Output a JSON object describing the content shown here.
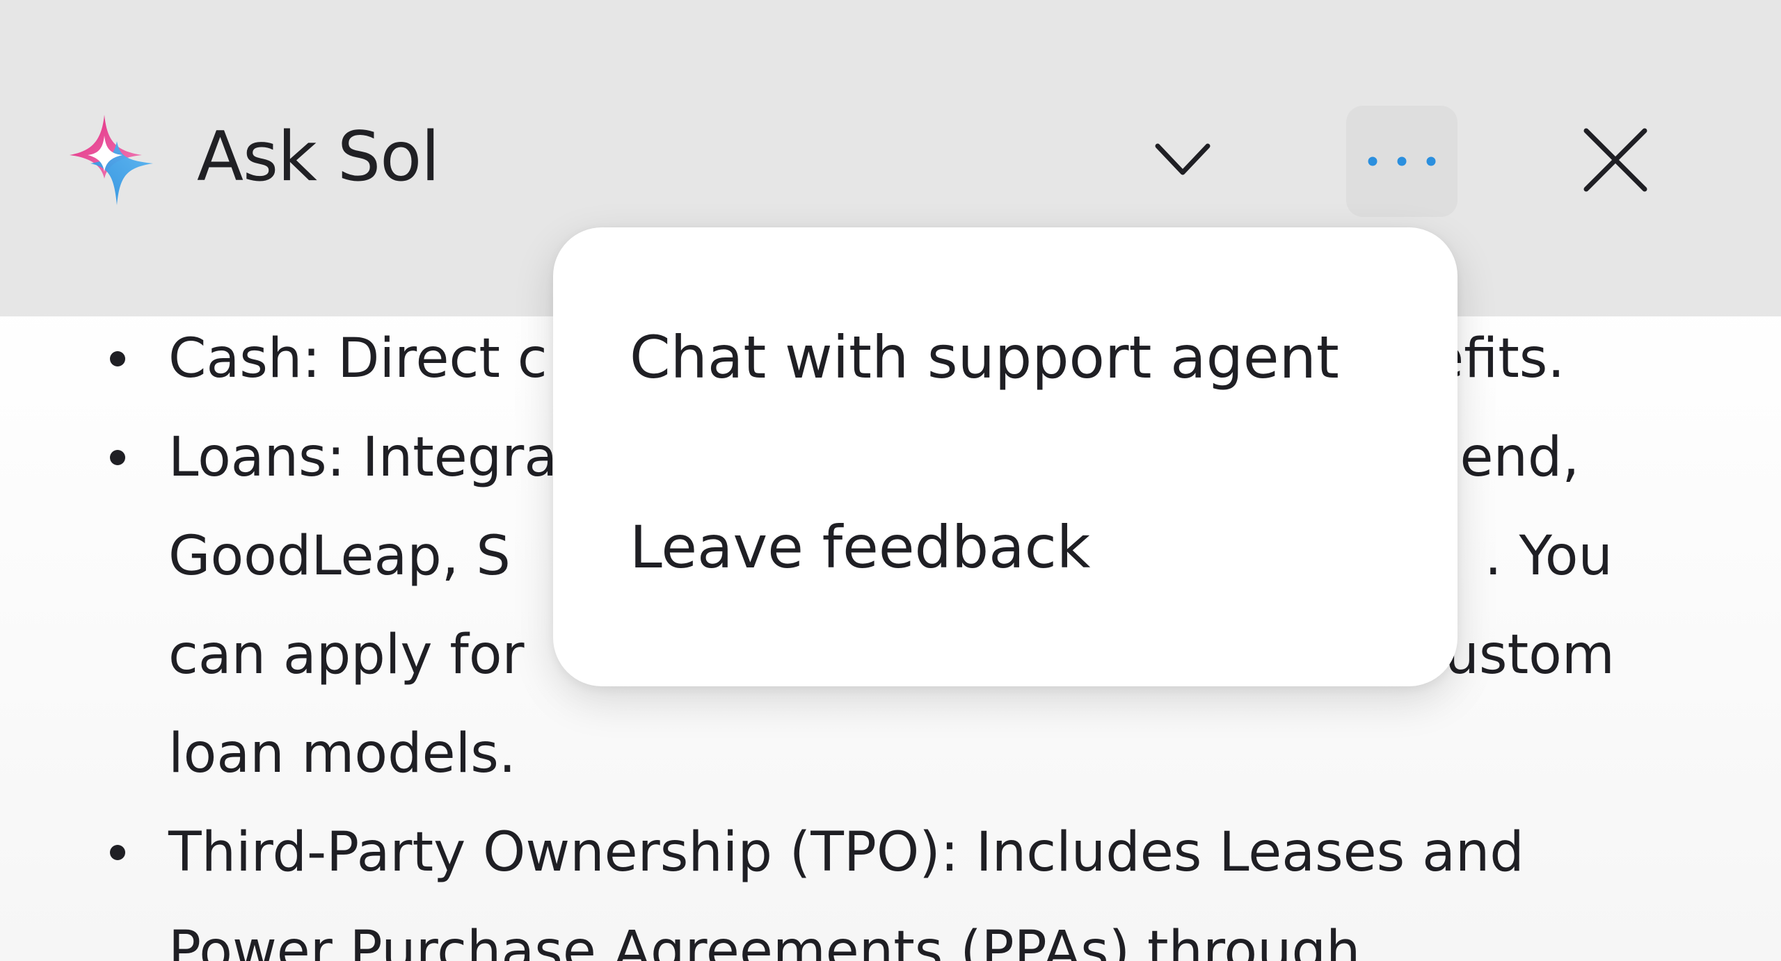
{
  "header": {
    "title": "Ask Sol",
    "icons": {
      "logo": "sparkle-logo-icon",
      "collapse": "chevron-down-icon",
      "more": "more-horizontal-icon",
      "close": "close-icon"
    },
    "colors": {
      "logo_pink": "#e2287f",
      "logo_blue": "#2b8fde",
      "more_dots": "#2b8fde",
      "header_bg": "#e6e6e6"
    }
  },
  "content": {
    "bullets": [
      "Cash: Direct c... nefits.",
      "Loans: Integr... vidend, GoodLeap, S... . You can apply for ... custom loan models.",
      "Third-Party Ownership (TPO): Includes Leases and Power Purchase Agreements (PPAs) through"
    ],
    "bullet_parts": {
      "b1_left": "Cash: Direct c",
      "b1_right": "nefits.",
      "b2_l1_left": "Loans: Integra",
      "b2_l1_right": "vidend,",
      "b2_l2_left": "GoodLeap, S",
      "b2_l2_right": ". You",
      "b2_l3_left": "can apply for",
      "b2_l3_right": "custom",
      "b2_l4": "loan models.",
      "b3_l1": "Third-Party Ownership (TPO): Includes Leases and",
      "b3_l2": "Power Purchase Agreements (PPAs) through"
    }
  },
  "menu": {
    "items": [
      "Chat with support agent",
      "Leave feedback"
    ]
  }
}
